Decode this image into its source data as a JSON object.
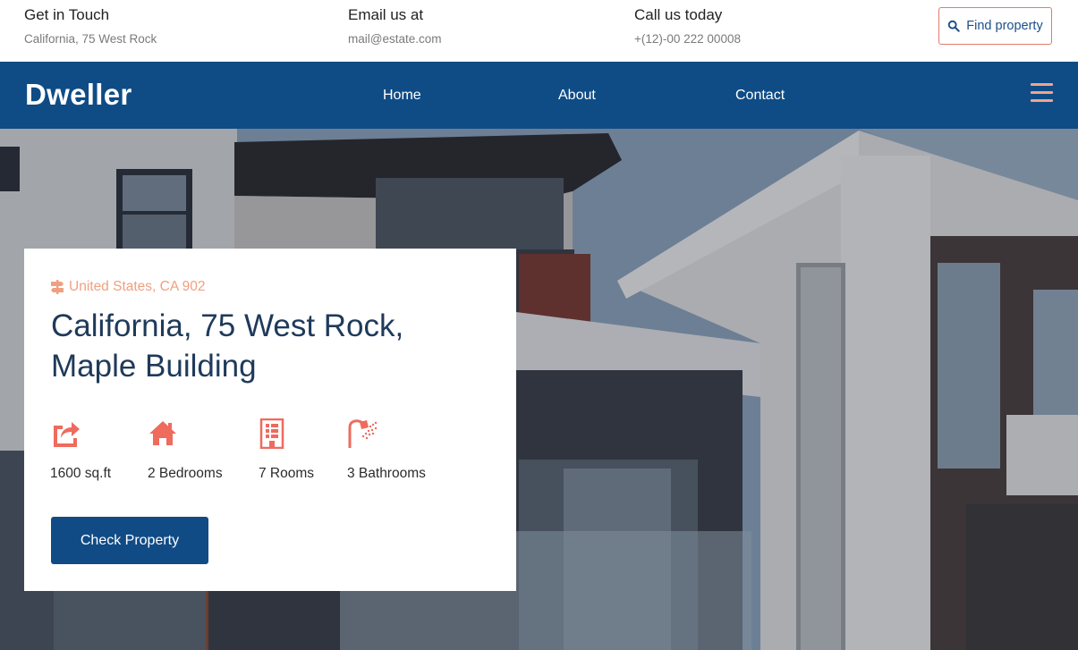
{
  "topbar": {
    "contact1": {
      "title": "Get in Touch",
      "sub": "California, 75 West Rock"
    },
    "contact2": {
      "title": "Email us at",
      "sub": "mail@estate.com"
    },
    "contact3": {
      "title": "Call us today",
      "sub": "+(12)-00 222 00008"
    },
    "find_label": "Find property"
  },
  "nav": {
    "logo": "Dweller",
    "links": [
      "Home",
      "About",
      "Contact"
    ]
  },
  "card": {
    "location": "United States, CA 902",
    "title": "California, 75 West Rock, Maple Building",
    "features": [
      {
        "icon": "share-arrow-icon",
        "label": "1600 sq.ft"
      },
      {
        "icon": "house-icon",
        "label": "2 Bedrooms"
      },
      {
        "icon": "building-icon",
        "label": "7 Rooms"
      },
      {
        "icon": "shower-icon",
        "label": "3 Bathrooms"
      }
    ],
    "button": "Check Property"
  },
  "colors": {
    "primary": "#0f4c85",
    "accent": "#ee6b5e",
    "location_accent": "#f0a080"
  }
}
